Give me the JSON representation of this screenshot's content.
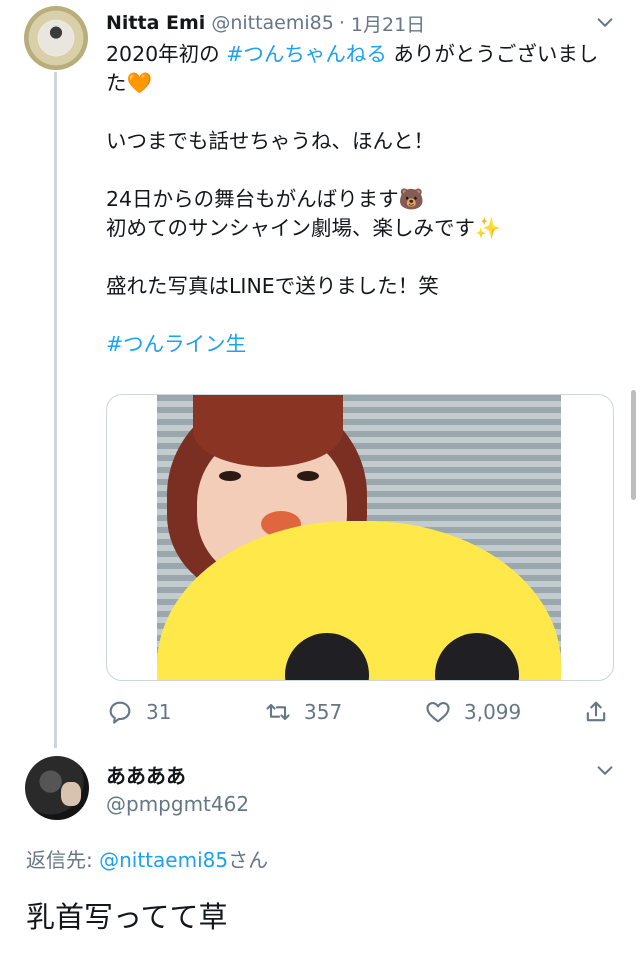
{
  "tweet": {
    "author_name": "Nitta Emi",
    "author_handle": "@nittaemi85",
    "separator": "·",
    "date": "1月21日",
    "line1_pre": "2020年初の ",
    "line1_tag": "#つんちゃんねる",
    "line1_post": " ありがとうございました",
    "line1_emoji": "🧡",
    "line2": "いつまでも話せちゃうね、ほんと！",
    "line3": "24日からの舞台もがんばります",
    "line3_emoji": "🐻",
    "line4": "初めてのサンシャイン劇場、楽しみです",
    "line4_emoji": "✨",
    "line5": "盛れた写真はLINEで送りました！笑",
    "hashtag": "#つんライン生"
  },
  "actions": {
    "replies": "31",
    "retweets": "357",
    "likes": "3,099"
  },
  "reply": {
    "author_name": "ああああ",
    "author_handle": "@pmpgmt462",
    "reply_to_label": "返信先: ",
    "reply_to_mention": "@nittaemi85",
    "reply_to_suffix": "さん",
    "text": "乳首写ってて草"
  },
  "colors": {
    "link": "#1da1f2",
    "secondary_text": "#657786",
    "primary_text": "#14171a",
    "divider": "#ccd6dd"
  },
  "icons": [
    "chevron-down-icon",
    "reply-icon",
    "retweet-icon",
    "like-icon",
    "share-icon"
  ]
}
